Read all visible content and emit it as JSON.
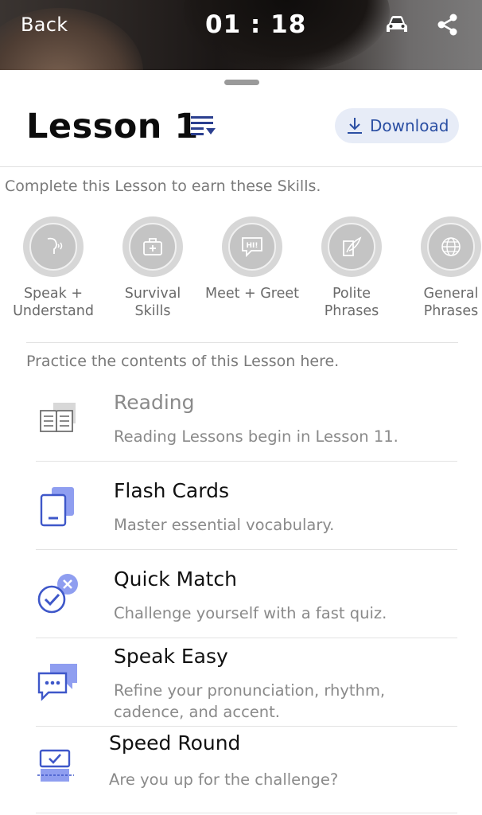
{
  "header": {
    "back_label": "Back",
    "timer": "01 : 18",
    "car_icon": "car-icon",
    "share_icon": "share-icon"
  },
  "lesson": {
    "title": "Lesson 1",
    "list_icon": "list-sort-icon",
    "download_label": "Download",
    "download_icon": "download-icon"
  },
  "skills": {
    "intro": "Complete this Lesson to earn these Skills.",
    "items": [
      {
        "label": "Speak +\nUnderstand",
        "icon": "speak-understand-icon"
      },
      {
        "label": "Survival\nSkills",
        "icon": "first-aid-kit-icon"
      },
      {
        "label": "Meet + Greet",
        "icon": "hi-speech-bubble-icon"
      },
      {
        "label": "Polite\nPhrases",
        "icon": "quill-paper-icon"
      },
      {
        "label": "General\nPhrases",
        "icon": "globe-icon"
      }
    ]
  },
  "practice": {
    "intro": "Practice the contents of this Lesson here.",
    "items": [
      {
        "title": "Reading",
        "description": "Reading Lessons begin in Lesson 11.",
        "icon": "book-icon"
      },
      {
        "title": "Flash Cards",
        "description": "Master essential vocabulary.",
        "icon": "flash-cards-icon"
      },
      {
        "title": "Quick Match",
        "description": "Challenge yourself with a fast quiz.",
        "icon": "quick-match-icon"
      },
      {
        "title": "Speak Easy",
        "description": "Refine your pronunciation, rhythm,\ncadence, and accent.",
        "icon": "chat-bubbles-icon"
      },
      {
        "title": "Speed Round",
        "description": "Are you up for the challenge?",
        "icon": "speed-round-icon"
      }
    ]
  },
  "colors": {
    "accent": "#5b6fe0",
    "download_bg": "#e7ecf7",
    "download_text": "#2b4fa3",
    "muted_text": "#7a7a7a",
    "skill_circle": "#d7d7d7"
  }
}
